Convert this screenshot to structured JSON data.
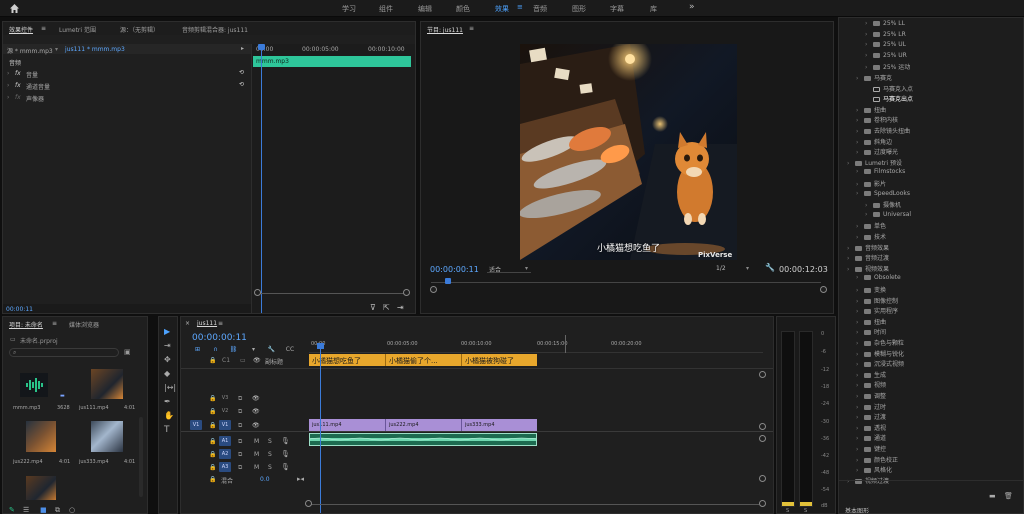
{
  "workspaces": {
    "items": [
      "学习",
      "组件",
      "编辑",
      "颜色",
      "效果",
      "音频",
      "图形",
      "字幕",
      "库"
    ],
    "active_index": 4,
    "more": "»"
  },
  "effect_controls": {
    "tabs": [
      "效果控件",
      "Lumetri 范围",
      "源：（无剪辑）",
      "音频剪辑混合器: jus111"
    ],
    "source_clip": "源 * mmm.mp3",
    "sequence_clip": "jus111 * mmm.mp3",
    "section": "音频",
    "items": [
      "音量",
      "通道音量",
      "声像器"
    ],
    "ruler": [
      "00:00",
      "00:00:05:00",
      "00:00:10:00"
    ],
    "clip_label": "mmm.mp3",
    "timecode": "00:00:11"
  },
  "program": {
    "title": "节目: jus111",
    "subtitle": "小橘猫想吃鱼了",
    "watermark": "PixVerse",
    "timecode": "00:00:00:11",
    "fit": "适合",
    "resolution": "1/2",
    "duration": "00:00:12:03",
    "controls": [
      "▾",
      "{",
      "}",
      "|◂",
      "◂|",
      "◂",
      "▶",
      "▸",
      "▸|",
      "⧉",
      "⧉",
      "⊕",
      "▣",
      "+"
    ]
  },
  "project": {
    "tabs": [
      "项目: 未命名",
      "媒体浏览器"
    ],
    "file": "未命名.prproj",
    "assets": [
      {
        "name": "mmm.mp3",
        "duration": "3628"
      },
      {
        "name": "jus111.mp4",
        "duration": "4:01"
      },
      {
        "name": "jus222.mp4",
        "duration": "4:01"
      },
      {
        "name": "jus333.mp4",
        "duration": "4:01"
      }
    ]
  },
  "timeline": {
    "tab": "jus111",
    "timecode": "00:00:00:11",
    "ruler": [
      "00:00",
      "00:00:05:00",
      "00:00:10:00",
      "00:00:15:00",
      "00:00:20:00"
    ],
    "subtitle_track": "副标题",
    "caption_clips": [
      "小橘猫想吃鱼了",
      "小橘猫偷了个...",
      "小橘猫被狗碰了"
    ],
    "video_tracks": [
      "V3",
      "V2",
      "V1"
    ],
    "audio_tracks": [
      "A1",
      "A2",
      "A3"
    ],
    "track_src": "V1",
    "video_clips": [
      "jus111.mp4",
      "jus222.mp4",
      "jus333.mp4"
    ],
    "mix_label": "混合",
    "mix_value": "0.0"
  },
  "meters": {
    "scale": [
      "0",
      "-6",
      "-12",
      "-18",
      "-24",
      "-30",
      "-36",
      "-42",
      "-48",
      "-54",
      "dB"
    ],
    "solo": [
      "S",
      "S"
    ]
  },
  "effects_tree": {
    "items": [
      {
        "label": "25% LL",
        "kind": "folder",
        "indent": 2
      },
      {
        "label": "25% LR",
        "kind": "folder",
        "indent": 2
      },
      {
        "label": "25% UL",
        "kind": "folder",
        "indent": 2
      },
      {
        "label": "25% UR",
        "kind": "folder",
        "indent": 2
      },
      {
        "label": "25% 运动",
        "kind": "folder",
        "indent": 2
      },
      {
        "label": "马赛克",
        "kind": "folder",
        "indent": 1
      },
      {
        "label": "马赛克入点",
        "kind": "preset",
        "indent": 2
      },
      {
        "label": "马赛克出点",
        "kind": "preset",
        "indent": 2,
        "selected": true
      },
      {
        "label": "扭曲",
        "kind": "folder",
        "indent": 1
      },
      {
        "label": "卷积内核",
        "kind": "folder",
        "indent": 1
      },
      {
        "label": "去除镜头扭曲",
        "kind": "folder",
        "indent": 1
      },
      {
        "label": "斜角边",
        "kind": "folder",
        "indent": 1
      },
      {
        "label": "过度曝光",
        "kind": "folder",
        "indent": 1
      },
      {
        "label": "Lumetri 预设",
        "kind": "folder",
        "indent": 0
      },
      {
        "label": "Filmstocks",
        "kind": "folder",
        "indent": 1
      },
      {
        "label": "影片",
        "kind": "folder",
        "indent": 1
      },
      {
        "label": "SpeedLooks",
        "kind": "folder",
        "indent": 1
      },
      {
        "label": "摄像机",
        "kind": "folder",
        "indent": 2
      },
      {
        "label": "Universal",
        "kind": "folder",
        "indent": 2
      },
      {
        "label": "单色",
        "kind": "folder",
        "indent": 1
      },
      {
        "label": "技术",
        "kind": "folder",
        "indent": 1
      },
      {
        "label": "音频效果",
        "kind": "folder",
        "indent": 0
      },
      {
        "label": "音频过渡",
        "kind": "folder",
        "indent": 0
      },
      {
        "label": "视频效果",
        "kind": "folder",
        "indent": 0
      },
      {
        "label": "Obsolete",
        "kind": "folder",
        "indent": 1
      },
      {
        "label": "变换",
        "kind": "folder",
        "indent": 1
      },
      {
        "label": "图像控制",
        "kind": "folder",
        "indent": 1
      },
      {
        "label": "实用程序",
        "kind": "folder",
        "indent": 1
      },
      {
        "label": "扭曲",
        "kind": "folder",
        "indent": 1
      },
      {
        "label": "时间",
        "kind": "folder",
        "indent": 1
      },
      {
        "label": "杂色与颗粒",
        "kind": "folder",
        "indent": 1
      },
      {
        "label": "模糊与锐化",
        "kind": "folder",
        "indent": 1
      },
      {
        "label": "沉浸式视频",
        "kind": "folder",
        "indent": 1
      },
      {
        "label": "生成",
        "kind": "folder",
        "indent": 1
      },
      {
        "label": "视频",
        "kind": "folder",
        "indent": 1
      },
      {
        "label": "调整",
        "kind": "folder",
        "indent": 1
      },
      {
        "label": "过时",
        "kind": "folder",
        "indent": 1
      },
      {
        "label": "过渡",
        "kind": "folder",
        "indent": 1
      },
      {
        "label": "透视",
        "kind": "folder",
        "indent": 1
      },
      {
        "label": "通道",
        "kind": "folder",
        "indent": 1
      },
      {
        "label": "键控",
        "kind": "folder",
        "indent": 1
      },
      {
        "label": "颜色校正",
        "kind": "folder",
        "indent": 1
      },
      {
        "label": "风格化",
        "kind": "folder",
        "indent": 1
      },
      {
        "label": "视频过渡",
        "kind": "folder",
        "indent": 0
      }
    ],
    "footer": "基本图形"
  }
}
